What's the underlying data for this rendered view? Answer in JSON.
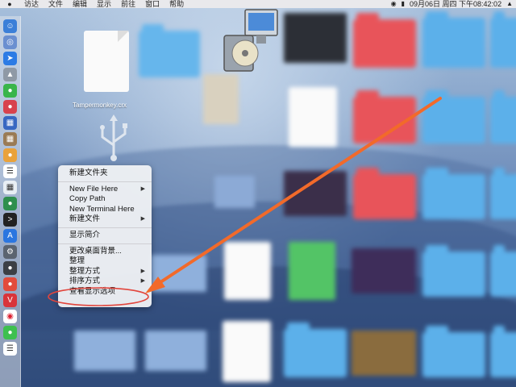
{
  "menubar": {
    "items": [
      "访达",
      "文件",
      "编辑",
      "显示",
      "前往",
      "窗口",
      "帮助"
    ],
    "clock": "09月06日 周四 下午08:42:02"
  },
  "desktop": {
    "crx_filename": "Tampermonkey.crx"
  },
  "context_menu": {
    "items": [
      {
        "label": "新建文件夹",
        "has_submenu": false
      },
      {
        "label": "New File Here",
        "has_submenu": true
      },
      {
        "label": "Copy Path",
        "has_submenu": false
      },
      {
        "label": "New Terminal Here",
        "has_submenu": false
      },
      {
        "label": "新建文件",
        "has_submenu": true
      },
      {
        "label": "显示简介",
        "has_submenu": false
      },
      {
        "label": "更改桌面背景...",
        "has_submenu": false
      },
      {
        "label": "整理",
        "has_submenu": false
      },
      {
        "label": "整理方式",
        "has_submenu": true
      },
      {
        "label": "排序方式",
        "has_submenu": true
      },
      {
        "label": "查看显示选项",
        "has_submenu": false
      }
    ],
    "highlighted": "查看显示选项"
  },
  "colors": {
    "annotation_arrow": "#f26a2a",
    "annotation_circle": "#e2453c",
    "folder_blue": "#5cb0ea",
    "folder_red": "#e8545a"
  }
}
